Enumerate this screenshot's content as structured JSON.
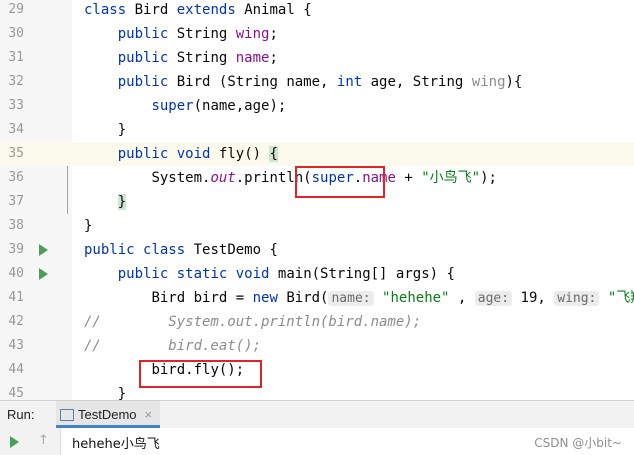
{
  "editor": {
    "lines": [
      {
        "num": "29"
      },
      {
        "num": "30"
      },
      {
        "num": "31"
      },
      {
        "num": "32"
      },
      {
        "num": "33"
      },
      {
        "num": "34"
      },
      {
        "num": "35"
      },
      {
        "num": "36"
      },
      {
        "num": "37"
      },
      {
        "num": "38"
      },
      {
        "num": "39"
      },
      {
        "num": "40"
      },
      {
        "num": "41"
      },
      {
        "num": "42"
      },
      {
        "num": "43"
      },
      {
        "num": "44"
      },
      {
        "num": "45"
      }
    ],
    "tokens": {
      "class": "class",
      "Bird": "Bird",
      "extends": "extends",
      "Animal": "Animal",
      "lbrace": "{",
      "rbrace": "}",
      "public": "public",
      "String": "String",
      "wing": "wing",
      "name": "name",
      "semi": ";",
      "ctor_open": "Bird (",
      "String_name": "String name, ",
      "int": "int",
      "age_param": " age, ",
      "String_wing": "String ",
      "ctor_close": "){",
      "super": "super",
      "super_call_args": "(name,age);",
      "void": "void",
      "fly": "fly",
      "parens_brace": "() ",
      "System": "System.",
      "out": "out",
      "println": ".println(",
      "super_name_dot": ".",
      "plus": " + ",
      "str_xiaoniaofei": "\"小鸟飞\"",
      "close_paren_semi": ");",
      "public_class": "class",
      "TestDemo": "TestDemo",
      "static": "static",
      "main_sig": "main(String[] args) {",
      "Bird_bird": "Bird bird = ",
      "new": "new",
      "Bird_open": " Bird(",
      "hint_name": "name:",
      "str_hehehe": "\"hehehe\"",
      "comma": " ,",
      "hint_age": "age:",
      "age_val": " 19,",
      "hint_wing": "wing:",
      "str_feixiang": "\"飞翔\"",
      "cm_slash": "//",
      "cm_line42": "        System.out.println(bird.name);",
      "cm_line43": "        bird.eat();",
      "bird_fly": "bird.fly();"
    }
  },
  "run_panel": {
    "label": "Run:",
    "tab_name": "TestDemo",
    "tab_close": "×",
    "output_text": "hehehe小鸟飞",
    "up_arrow": "↑"
  },
  "watermark": "CSDN @小bit~",
  "colors": {
    "keyword": "#0033b3",
    "field": "#871094",
    "string": "#067d17",
    "comment": "#8c8c8c",
    "highlight_box": "#e02424",
    "run_green": "#4aa058"
  },
  "icons": {
    "run": "run-gutter-icon",
    "tab": "run-config-icon",
    "rerun": "play-icon"
  }
}
